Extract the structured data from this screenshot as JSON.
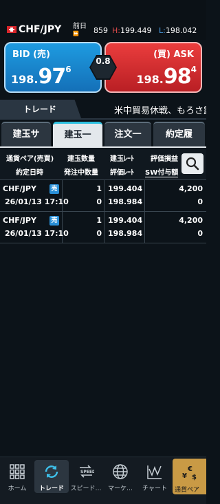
{
  "header": {
    "pair": "CHF/JPY",
    "prev_day_label": "前日",
    "prev_day_arrow": "⏩",
    "prev_day_value": "859",
    "high_key": "H:",
    "high_value": "199.449",
    "low_key": "L:",
    "low_value": "198.042"
  },
  "bid": {
    "label": "BID (売)",
    "price_head": "198.",
    "price_big": "97",
    "price_sup": "6"
  },
  "ask": {
    "label": "(買) ASK",
    "price_head": "198.",
    "price_big": "98",
    "price_sup": "4"
  },
  "spread": "0.8",
  "trade_tab": "トレード",
  "ticker": "米中貿易休戦、もろさ露呈",
  "subtabs": [
    "建玉サ",
    "建玉一",
    "注文一",
    "約定履"
  ],
  "active_subtab": 1,
  "table": {
    "headers": {
      "pair_side": "通貨ペア(売買)",
      "exec_datetime": "約定日時",
      "position_qty": "建玉数量",
      "pending_qty": "発注中数量",
      "position_rate": "建玉ﾚｰﾄ",
      "eval_rate": "評価ﾚｰﾄ",
      "eval_pl": "評価損益",
      "sw_amount": "SW付与額"
    },
    "rows": [
      {
        "pair": "CHF/JPY",
        "side": "売",
        "datetime": "26/01/13 17:10",
        "qty": "1",
        "pending": "0",
        "rate": "199.404",
        "eval_rate": "198.984",
        "pl": "4,200",
        "sw": "0"
      },
      {
        "pair": "CHF/JPY",
        "side": "売",
        "datetime": "26/01/13 17:10",
        "qty": "1",
        "pending": "0",
        "rate": "199.404",
        "eval_rate": "198.984",
        "pl": "4,200",
        "sw": "0"
      }
    ]
  },
  "nav": [
    {
      "label": "ホーム",
      "icon": "grid-icon"
    },
    {
      "label": "トレード",
      "icon": "refresh-icon"
    },
    {
      "label": "スピード…",
      "icon": "speed-icon"
    },
    {
      "label": "マーケ…",
      "icon": "globe-icon"
    },
    {
      "label": "チャート",
      "icon": "chart-icon"
    }
  ],
  "nav_pair": {
    "label": "通貨ペア",
    "symbols": [
      "€",
      "¥",
      "$"
    ]
  }
}
